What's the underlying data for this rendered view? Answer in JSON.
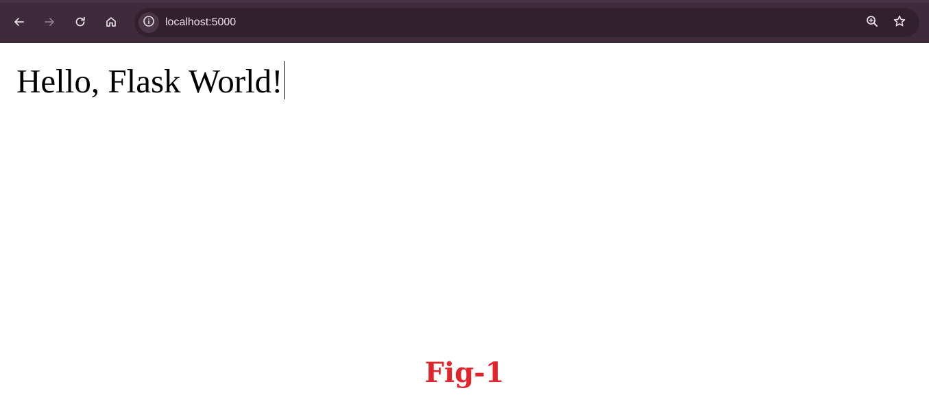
{
  "browser": {
    "url": "localhost:5000",
    "nav": {
      "back_icon": "arrow-left-icon",
      "forward_icon": "arrow-right-icon",
      "reload_icon": "reload-icon",
      "home_icon": "home-icon"
    },
    "omnibox_icons": {
      "site_info_icon": "info-circle-icon",
      "zoom_icon": "zoom-in-icon",
      "bookmark_icon": "star-outline-icon"
    },
    "colors": {
      "toolbar_bg": "#3f2a3c",
      "omnibox_bg": "#33202f",
      "icon_color": "#e8dfe6",
      "icon_disabled_color": "#8f7a8b"
    }
  },
  "page": {
    "heading": "Hello, Flask World!"
  },
  "caption": {
    "text": "Fig-1",
    "color": "#e3242b"
  }
}
